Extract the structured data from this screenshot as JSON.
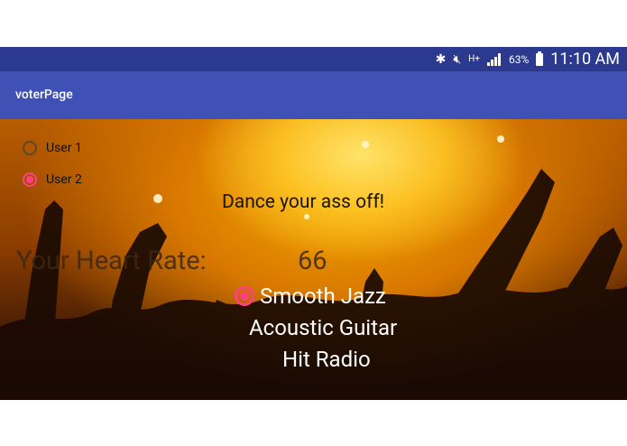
{
  "status_bar": {
    "battery": "63%",
    "time": "11:10 AM",
    "icons": [
      "bluetooth-icon",
      "mute-icon",
      "data-icon",
      "signal-icon",
      "battery-icon"
    ]
  },
  "app_bar": {
    "title": "voterPage"
  },
  "users": [
    {
      "label": "User 1",
      "checked": false
    },
    {
      "label": "User 2",
      "checked": true
    }
  ],
  "tagline": "Dance your ass off!",
  "heart_rate": {
    "label": "Your Heart Rate:",
    "value": "66"
  },
  "stations": [
    {
      "label": "Smooth Jazz",
      "checked": true
    },
    {
      "label": "Acoustic Guitar",
      "checked": false
    },
    {
      "label": "Hit Radio",
      "checked": false
    }
  ],
  "colors": {
    "status_bar": "#2b3a8f",
    "app_bar": "#3f51b5",
    "accent": "#ff4081"
  }
}
